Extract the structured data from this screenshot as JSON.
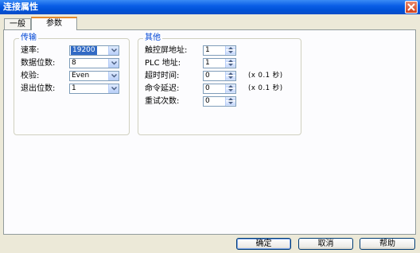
{
  "window": {
    "title": "连接属性"
  },
  "tabs": [
    {
      "label": "一般"
    },
    {
      "label": "参数"
    }
  ],
  "transfer_group": {
    "title": "传输",
    "rows": [
      {
        "label": "速率:",
        "value": "19200"
      },
      {
        "label": "数据位数:",
        "value": "8"
      },
      {
        "label": "校验:",
        "value": "Even"
      },
      {
        "label": "退出位数:",
        "value": "1"
      }
    ]
  },
  "other_group": {
    "title": "其他",
    "rows": [
      {
        "label": "触控屏地址:",
        "value": "1",
        "note": ""
      },
      {
        "label": "PLC 地址:",
        "value": "1",
        "note": ""
      },
      {
        "label": "超时时间:",
        "value": "0",
        "note": "(x 0.1 秒)"
      },
      {
        "label": "命令延迟:",
        "value": "0",
        "note": "(x 0.1 秒)"
      },
      {
        "label": "重试次数:",
        "value": "0",
        "note": ""
      }
    ]
  },
  "buttons": {
    "ok": "确定",
    "cancel": "取消",
    "help": "帮助"
  }
}
